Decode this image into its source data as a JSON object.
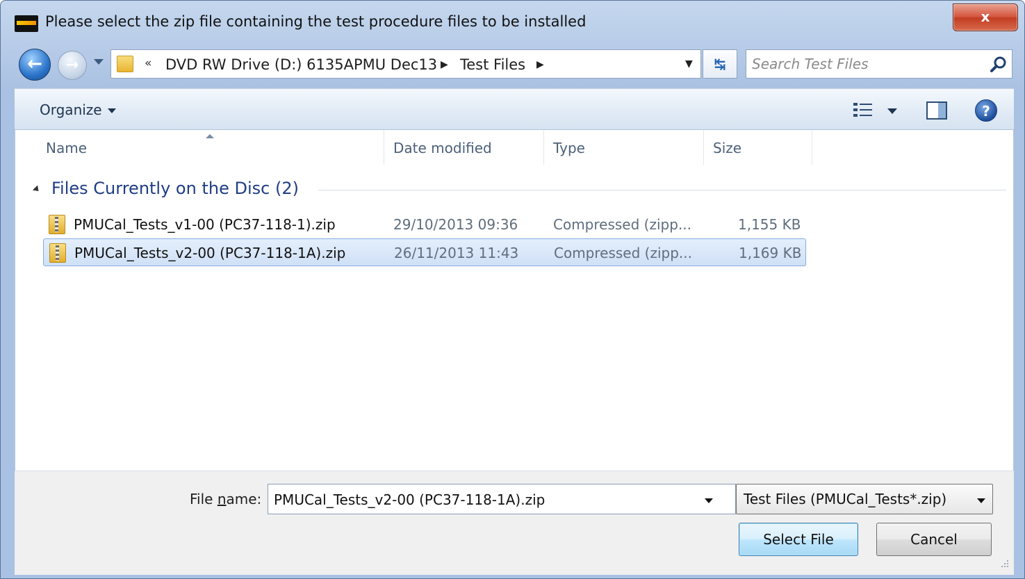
{
  "window": {
    "title": "Please select the zip file containing the test procedure files to be installed",
    "close_label": "x"
  },
  "address": {
    "overflow_label": "«",
    "breadcrumbs": [
      "DVD RW Drive (D:) 6135APMU Dec13",
      "Test Files"
    ]
  },
  "search": {
    "placeholder": "Search Test Files"
  },
  "toolbar": {
    "organize_label": "Organize"
  },
  "columns": {
    "name": "Name",
    "date": "Date modified",
    "type": "Type",
    "size": "Size"
  },
  "group": {
    "title": "Files Currently on the Disc (2)"
  },
  "files": [
    {
      "name": "PMUCal_Tests_v1-00 (PC37-118-1).zip",
      "date": "29/10/2013 09:36",
      "type": "Compressed (zipp...",
      "size": "1,155 KB",
      "selected": false
    },
    {
      "name": "PMUCal_Tests_v2-00 (PC37-118-1A).zip",
      "date": "26/11/2013 11:43",
      "type": "Compressed (zipp...",
      "size": "1,169 KB",
      "selected": true
    }
  ],
  "bottom": {
    "file_name_label_pre": "File ",
    "file_name_label_accel": "n",
    "file_name_label_post": "ame:",
    "file_name_value": "PMUCal_Tests_v2-00 (PC37-118-1A).zip",
    "filter_value": "Test Files (PMUCal_Tests*.zip)",
    "select_label": "Select File",
    "cancel_label": "Cancel"
  },
  "icons": {
    "app": "app-icon",
    "back": "back-arrow-icon",
    "forward": "forward-arrow-icon",
    "refresh": "refresh-icon",
    "search": "search-icon",
    "views": "views-icon",
    "preview": "preview-pane-icon",
    "help": "help-icon",
    "zip": "zip-folder-icon"
  },
  "colors": {
    "group_title": "#1f3d84",
    "selection": "#cfe0f6",
    "close_button": "#c23d22"
  }
}
